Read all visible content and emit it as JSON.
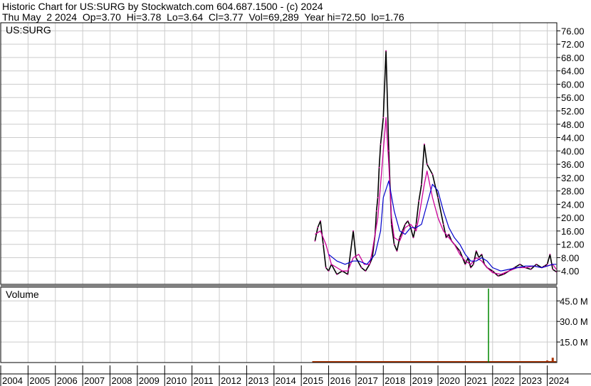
{
  "header": {
    "line1": "Historic Chart for US:SURG by Stockwatch.com 604.687.1500 - (c) 2024",
    "line2": "Thu May  2 2024  Op=3.70  Hi=3.78  Lo=3.64  Cl=3.77  Vol=69,289  Year hi=72.50  lo=1.76"
  },
  "chart_data": [
    {
      "type": "line",
      "title": "US:SURG",
      "price_label": "US:SURG",
      "ylim": [
        0,
        78
      ],
      "yticks": [
        "76.00",
        "72.00",
        "68.00",
        "64.00",
        "60.00",
        "56.00",
        "52.00",
        "48.00",
        "44.00",
        "40.00",
        "36.00",
        "32.00",
        "28.00",
        "24.00",
        "20.00",
        "16.00",
        "12.00",
        "8.00",
        "4.00"
      ],
      "grid": true,
      "colors": {
        "price": "#000000",
        "ma_short": "#cc0099",
        "ma_long": "#0000cc",
        "grid": "#cccccc"
      },
      "series": [
        {
          "style": "price",
          "x": [
            2015.5,
            2015.6,
            2015.7,
            2015.8,
            2015.9,
            2016.0,
            2016.1,
            2016.3,
            2016.5,
            2016.7,
            2016.9,
            2017.0,
            2017.2,
            2017.35,
            2017.5,
            2017.6,
            2017.7,
            2017.75,
            2017.8,
            2017.85,
            2017.9,
            2018.0,
            2018.1,
            2018.2,
            2018.3,
            2018.4,
            2018.5,
            2018.6,
            2018.7,
            2018.8,
            2018.9,
            2019.0,
            2019.1,
            2019.2,
            2019.3,
            2019.4,
            2019.5,
            2019.6,
            2019.8,
            2020.0,
            2020.2,
            2020.3,
            2020.4,
            2020.5,
            2020.6,
            2020.8,
            2021.0,
            2021.1,
            2021.2,
            2021.3,
            2021.4,
            2021.5,
            2021.6,
            2021.7,
            2021.8,
            2022.0,
            2022.2,
            2022.4,
            2022.6,
            2022.8,
            2023.0,
            2023.2,
            2023.4,
            2023.6,
            2023.8,
            2023.9,
            2024.0,
            2024.1,
            2024.2,
            2024.33
          ],
          "y": [
            13,
            17,
            19,
            12,
            5,
            4,
            6,
            3,
            4,
            3,
            16,
            8,
            5,
            4,
            6,
            8,
            15,
            22,
            26,
            35,
            42,
            50,
            70,
            40,
            18,
            12,
            10,
            14,
            16,
            18,
            19,
            17,
            14,
            18,
            25,
            30,
            42,
            36,
            33,
            26,
            18,
            14,
            15,
            13,
            12,
            10,
            6,
            8,
            5,
            6,
            10,
            8,
            9,
            6,
            5,
            4,
            2.5,
            3,
            4,
            5,
            6,
            5,
            4.5,
            6,
            5,
            5.5,
            6,
            9,
            4.5,
            3.77
          ]
        },
        {
          "style": "ma_short",
          "x": [
            2015.5,
            2015.7,
            2015.9,
            2016.1,
            2016.3,
            2016.5,
            2016.7,
            2016.9,
            2017.1,
            2017.3,
            2017.5,
            2017.6,
            2017.8,
            2017.9,
            2018.0,
            2018.1,
            2018.2,
            2018.3,
            2018.4,
            2018.6,
            2018.8,
            2019.0,
            2019.2,
            2019.3,
            2019.5,
            2019.6,
            2019.8,
            2020.0,
            2020.2,
            2020.4,
            2020.6,
            2020.8,
            2021.0,
            2021.2,
            2021.4,
            2021.6,
            2021.8,
            2022.0,
            2022.3,
            2022.6,
            2022.9,
            2023.2,
            2023.5,
            2023.8,
            2024.0,
            2024.2,
            2024.33
          ],
          "y": [
            15,
            16,
            12,
            6,
            5,
            4,
            4,
            8,
            9,
            6,
            6,
            10,
            20,
            30,
            40,
            50,
            36,
            20,
            14,
            13,
            17,
            18,
            16,
            20,
            30,
            34,
            26,
            20,
            16,
            14,
            12,
            9,
            7,
            6,
            8,
            7,
            5,
            3.5,
            3,
            4,
            5,
            5,
            5.5,
            5,
            5.5,
            6,
            4.5
          ]
        },
        {
          "style": "ma_long",
          "x": [
            2016.0,
            2016.3,
            2016.6,
            2016.9,
            2017.1,
            2017.4,
            2017.7,
            2017.9,
            2018.0,
            2018.2,
            2018.4,
            2018.6,
            2018.8,
            2019.0,
            2019.2,
            2019.4,
            2019.6,
            2019.8,
            2020.0,
            2020.2,
            2020.4,
            2020.6,
            2020.8,
            2021.0,
            2021.2,
            2021.4,
            2021.6,
            2021.8,
            2022.0,
            2022.3,
            2022.6,
            2022.9,
            2023.2,
            2023.5,
            2023.8,
            2024.0,
            2024.2,
            2024.33
          ],
          "y": [
            9,
            7,
            6,
            7,
            7,
            6,
            9,
            16,
            26,
            31,
            22,
            16,
            15,
            17,
            17,
            18,
            24,
            30,
            28,
            22,
            17,
            14,
            12,
            9,
            7,
            7,
            8,
            7,
            5,
            4,
            4.5,
            5,
            5.5,
            5.5,
            5,
            5.5,
            6,
            6
          ]
        }
      ]
    },
    {
      "type": "bar",
      "title": "Volume",
      "volume_label": "Volume",
      "ylim": [
        0,
        55
      ],
      "yticks": [
        "45.0 M",
        "30.0 M",
        "15.0 M"
      ],
      "grid": true,
      "colors": {
        "volume": "#008800",
        "volume_small": "#aa3300"
      },
      "spike": {
        "x": 2021.85,
        "value": 54
      },
      "x": [
        2015.5,
        2016.0,
        2016.5,
        2017.0,
        2017.5,
        2018.0,
        2018.5,
        2019.0,
        2019.5,
        2020.0,
        2020.5,
        2021.0,
        2021.5,
        2022.0,
        2022.5,
        2023.0,
        2023.5,
        2024.0,
        2024.2
      ],
      "values": [
        0.3,
        0.3,
        0.4,
        0.4,
        0.5,
        0.8,
        0.6,
        0.7,
        0.8,
        0.6,
        0.6,
        0.8,
        1.0,
        0.5,
        0.6,
        0.7,
        0.9,
        1.5,
        3.5
      ]
    }
  ],
  "xaxis": {
    "ticks": [
      "2004",
      "2005",
      "2006",
      "2007",
      "2008",
      "2009",
      "2010",
      "2011",
      "2012",
      "2013",
      "2014",
      "2015",
      "2016",
      "2017",
      "2018",
      "2019",
      "2020",
      "2021",
      "2022",
      "2023",
      "2024"
    ],
    "range": [
      2004,
      2024.35
    ]
  }
}
